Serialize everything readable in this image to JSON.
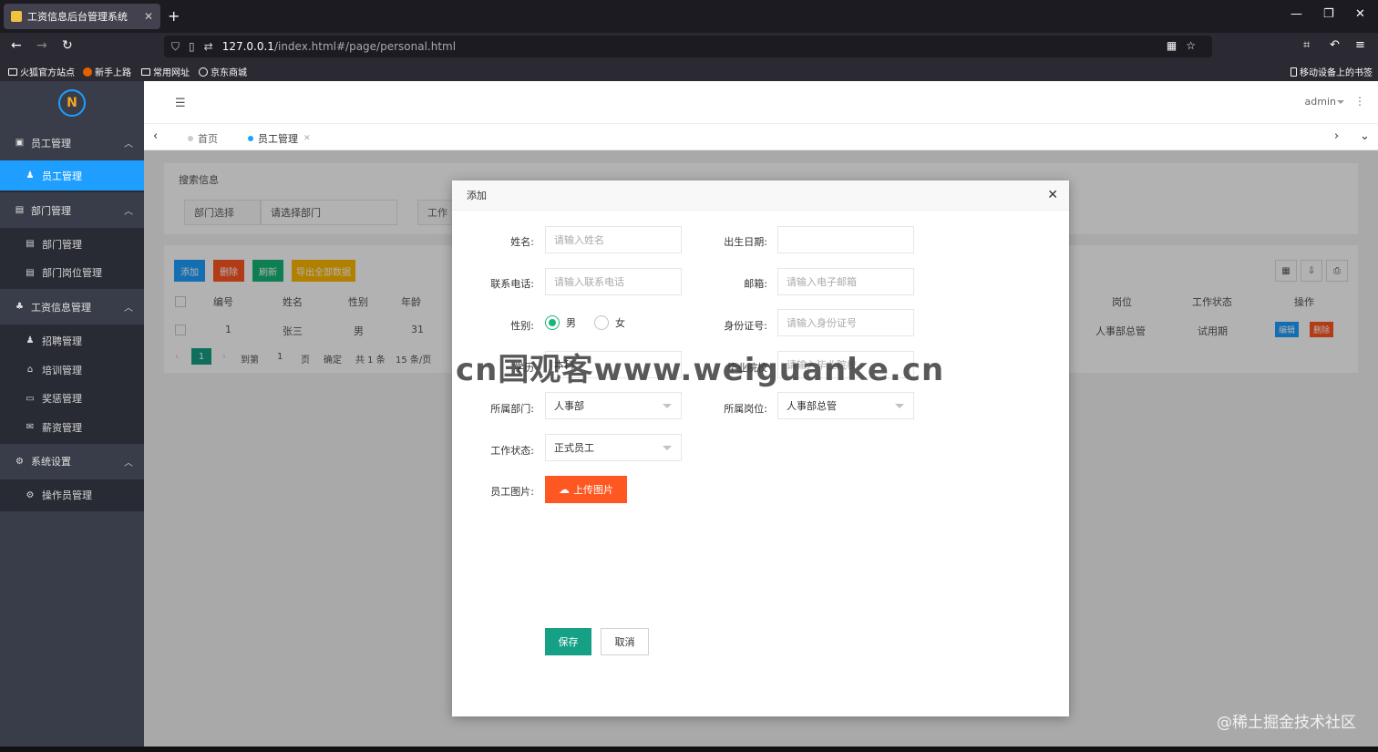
{
  "browser": {
    "tab_title": "工资信息后台管理系统",
    "url_host": "127.0.0.1",
    "url_path": "/index.html#/page/personal.html",
    "bookmarks": [
      "火狐官方站点",
      "新手上路",
      "常用网址",
      "京东商城"
    ],
    "mobile_bookmarks": "移动设备上的书签"
  },
  "sidebar": {
    "groups": [
      {
        "label": "员工管理",
        "icon": "id-card-icon",
        "items": [
          {
            "label": "员工管理",
            "active": true
          }
        ]
      },
      {
        "label": "部门管理",
        "icon": "building-icon",
        "items": [
          {
            "label": "部门管理"
          },
          {
            "label": "部门岗位管理"
          }
        ]
      },
      {
        "label": "工资信息管理",
        "icon": "users-icon",
        "items": [
          {
            "label": "招聘管理"
          },
          {
            "label": "培训管理"
          },
          {
            "label": "奖惩管理"
          },
          {
            "label": "薪资管理"
          }
        ]
      },
      {
        "label": "系统设置",
        "icon": "gears-icon",
        "items": [
          {
            "label": "操作员管理"
          }
        ]
      }
    ]
  },
  "topbar": {
    "user": "admin"
  },
  "page_tabs": [
    {
      "label": "首页"
    },
    {
      "label": "员工管理",
      "active": true
    }
  ],
  "search": {
    "title": "搜索信息",
    "dept_label": "部门选择",
    "dept_placeholder": "请选择部门",
    "status_label_partial": "工作"
  },
  "toolbar": {
    "add": "添加",
    "delete": "删除",
    "refresh": "刷新",
    "export": "导出全部数据"
  },
  "table": {
    "headers_left": [
      "编号",
      "姓名",
      "性别",
      "年龄"
    ],
    "headers_right": [
      "岗位",
      "工作状态",
      "操作"
    ],
    "rows": [
      {
        "id": "1",
        "name": "张三",
        "gender": "男",
        "age": "31",
        "post": "人事部总管",
        "status": "试用期",
        "edit": "编辑",
        "del": "删除"
      }
    ]
  },
  "pager": {
    "current": "1",
    "goto_label": "到第",
    "goto_value": "1",
    "page_unit": "页",
    "confirm": "确定",
    "total": "共 1 条",
    "per_page": "15 条/页"
  },
  "modal": {
    "title": "添加",
    "fields": {
      "name_label": "姓名:",
      "name_placeholder": "请输入姓名",
      "birth_label": "出生日期:",
      "phone_label": "联系电话:",
      "phone_placeholder": "请输入联系电话",
      "email_label": "邮箱:",
      "email_placeholder": "请输入电子邮箱",
      "gender_label": "性别:",
      "gender_male": "男",
      "gender_female": "女",
      "idcard_label": "身份证号:",
      "idcard_placeholder": "请输入身份证号",
      "edu_label_partial": "学历",
      "edu_value_partial": "本科",
      "grad_label_partial": "毕业院校",
      "grad_placeholder_partial": "请输入毕业院校",
      "dept_label": "所属部门:",
      "dept_value": "人事部",
      "post_label": "所属岗位:",
      "post_value": "人事部总管",
      "status_label": "工作状态:",
      "status_value": "正式员工",
      "photo_label": "员工图片:",
      "upload": "上传图片"
    },
    "save": "保存",
    "cancel": "取消"
  },
  "watermarks": {
    "main": "cn国观客www.weiguanke.cn",
    "corner": "@稀土掘金技术社区"
  }
}
